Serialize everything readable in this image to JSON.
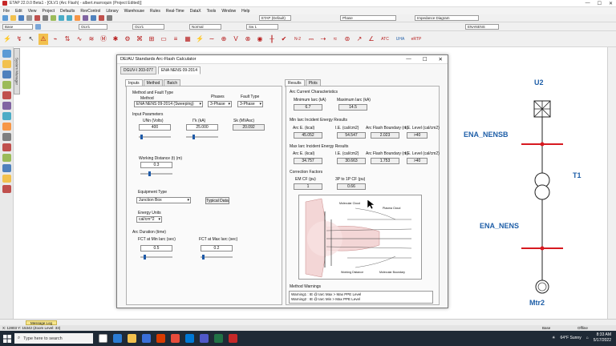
{
  "window": {
    "title": "ETAP 22.0.0 Beta1 - [OLV1 (Arc Flash) - albert.marroquin (Project Edited)]",
    "controls": [
      "—",
      "☐",
      "✕"
    ]
  },
  "menu": [
    "File",
    "Edit",
    "View",
    "Project",
    "Defaults",
    "RevControl",
    "Library",
    "Warehouse",
    "Rules",
    "Real-Time",
    "DataX",
    "Tools",
    "Window",
    "Help"
  ],
  "toolbar": {
    "combos": [
      "Base",
      "OLV1",
      "OLV1",
      "Normal",
      "Sw 1",
      "ETAP (Default)",
      "Phase",
      "Impedance Diagram",
      "ENANENS"
    ],
    "n2_label": "N-2",
    "atc_label": "ATC",
    "uha_label": "UHA",
    "etp_label": "eRTP"
  },
  "sidebar": {
    "tab_label": "System Manager"
  },
  "dialog": {
    "title": "DE/AU Standards Arc-Flash Calculator",
    "controls": [
      "—",
      "☐",
      "✕"
    ],
    "top_tabs": [
      "DGUV-I 203-077",
      "ENA NENS 09-2014"
    ],
    "left_tabs": [
      "Inputs",
      "Method",
      "Batch"
    ],
    "right_tabs": [
      "Results",
      "Plots"
    ],
    "method_section": {
      "heading": "Method and Fault Type",
      "method_label": "Method",
      "method_value": "ENA NENS 09-2014 (Sweeping)",
      "phases_label": "Phases",
      "phases_value": "3-Phase",
      "fault_type_label": "Fault Type",
      "fault_type_value": "3-Phase"
    },
    "input_params": {
      "heading": "Input Parameters",
      "unom_label": "UNn (Volts)",
      "unom_value": "400",
      "ik_label": "I\"k (kA)",
      "ik_value": "25.000",
      "sk_label": "Sk (MVAsc)",
      "sk_value": "20.092",
      "wd_label": "Working Distance (t) (m)",
      "wd_value": "0.3",
      "equipment_label": "Equipment Type",
      "equipment_value": "Junction Box",
      "typical_button": "Typical Data",
      "energy_label": "Energy Units",
      "energy_value": "cal/cm^2"
    },
    "arc_duration": {
      "heading": "Arc Duration (time)",
      "fct_min_label": "FCT at Min Iarc (sec)",
      "fct_min_value": "0.5",
      "fct_max_label": "FCT at Max Iarc (sec)",
      "fct_max_value": "0.2"
    },
    "results": {
      "arc_current_heading": "Arc Current Characteristics",
      "min_iarc_label": "Minimum Iarc (kA)",
      "min_iarc_value": "6.7",
      "max_iarc_label": "Maximum Iarc (kA)",
      "max_iarc_value": "14.5",
      "min_energy_heading": "Min Iarc Incident Energy Results",
      "max_energy_heading": "Max Iarc Incident Energy Results",
      "col_arc_e": "Arc E. (kcal)",
      "col_ie": "I.E. (cal/cm2)",
      "col_boundary": "Arc Flash Boundary (m)",
      "col_level": "I.E. Level (cal/cm2)",
      "min_row": [
        "45.052",
        "54.547",
        "2.023",
        ">40"
      ],
      "max_row": [
        "34.757",
        "30.663",
        "1.753",
        ">40"
      ],
      "correction_heading": "Correction Factors",
      "em_cf_label": "EM CF (pu)",
      "em_cf_value": "1",
      "cf_3p1p_label": "3P to 1P CF (pu)",
      "cf_3p1p_value": "0.66",
      "warnings_heading": "Method Warnings",
      "warnings": [
        "Warning1 : IE @ Iarc Max > Max PPE Level",
        "Warning2 : IE @ Iarc Min > Max PPE Level"
      ]
    },
    "figure_labels": {
      "cloud": "Molecular Cloud",
      "plasma": "Plasma Cloud",
      "working": "Working Distance",
      "boundary": "Molecular Boundary"
    }
  },
  "diagram": {
    "u2_label": "U2",
    "bus1_label": "ENA_NENSB",
    "t1_label": "T1",
    "bus2_label": "ENA_NENS",
    "motor_label": "Mtr2",
    "bus_color": "#d71920",
    "label_color": "#1f5fa8"
  },
  "message_log": {
    "tab_label": "Message Log"
  },
  "status": {
    "left": "X: 12803  Y: 15342 (Zoom Level: 33)",
    "right_items": [
      "Base",
      "Offline"
    ]
  },
  "taskbar": {
    "search_placeholder": "Type here to search",
    "weather": "64°F  Sunny",
    "time": "8:33 AM",
    "date": "5/17/2022"
  }
}
